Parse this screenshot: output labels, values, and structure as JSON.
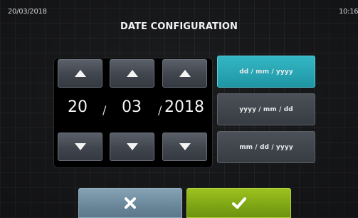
{
  "status_bar": {
    "date": "20/03/2018",
    "time": "10:16"
  },
  "title": "DATE CONFIGURATION",
  "date_picker": {
    "fields": [
      {
        "name": "day",
        "value": "20"
      },
      {
        "name": "month",
        "value": "03"
      },
      {
        "name": "year",
        "value": "2018"
      }
    ],
    "separators": [
      "/",
      "/"
    ],
    "up_icon": "triangle-up-icon",
    "down_icon": "triangle-down-icon"
  },
  "formats": {
    "options": [
      "dd / mm / yyyy",
      "yyyy / mm / dd",
      "mm / dd / yyyy"
    ],
    "selected": "dd / mm / yyyy"
  },
  "actions": {
    "cancel_icon": "x-icon",
    "confirm_icon": "checkmark-icon"
  },
  "colors": {
    "selected_format": "#26a6b4",
    "confirm": "#8ab21a",
    "cancel": "#7693a6"
  }
}
